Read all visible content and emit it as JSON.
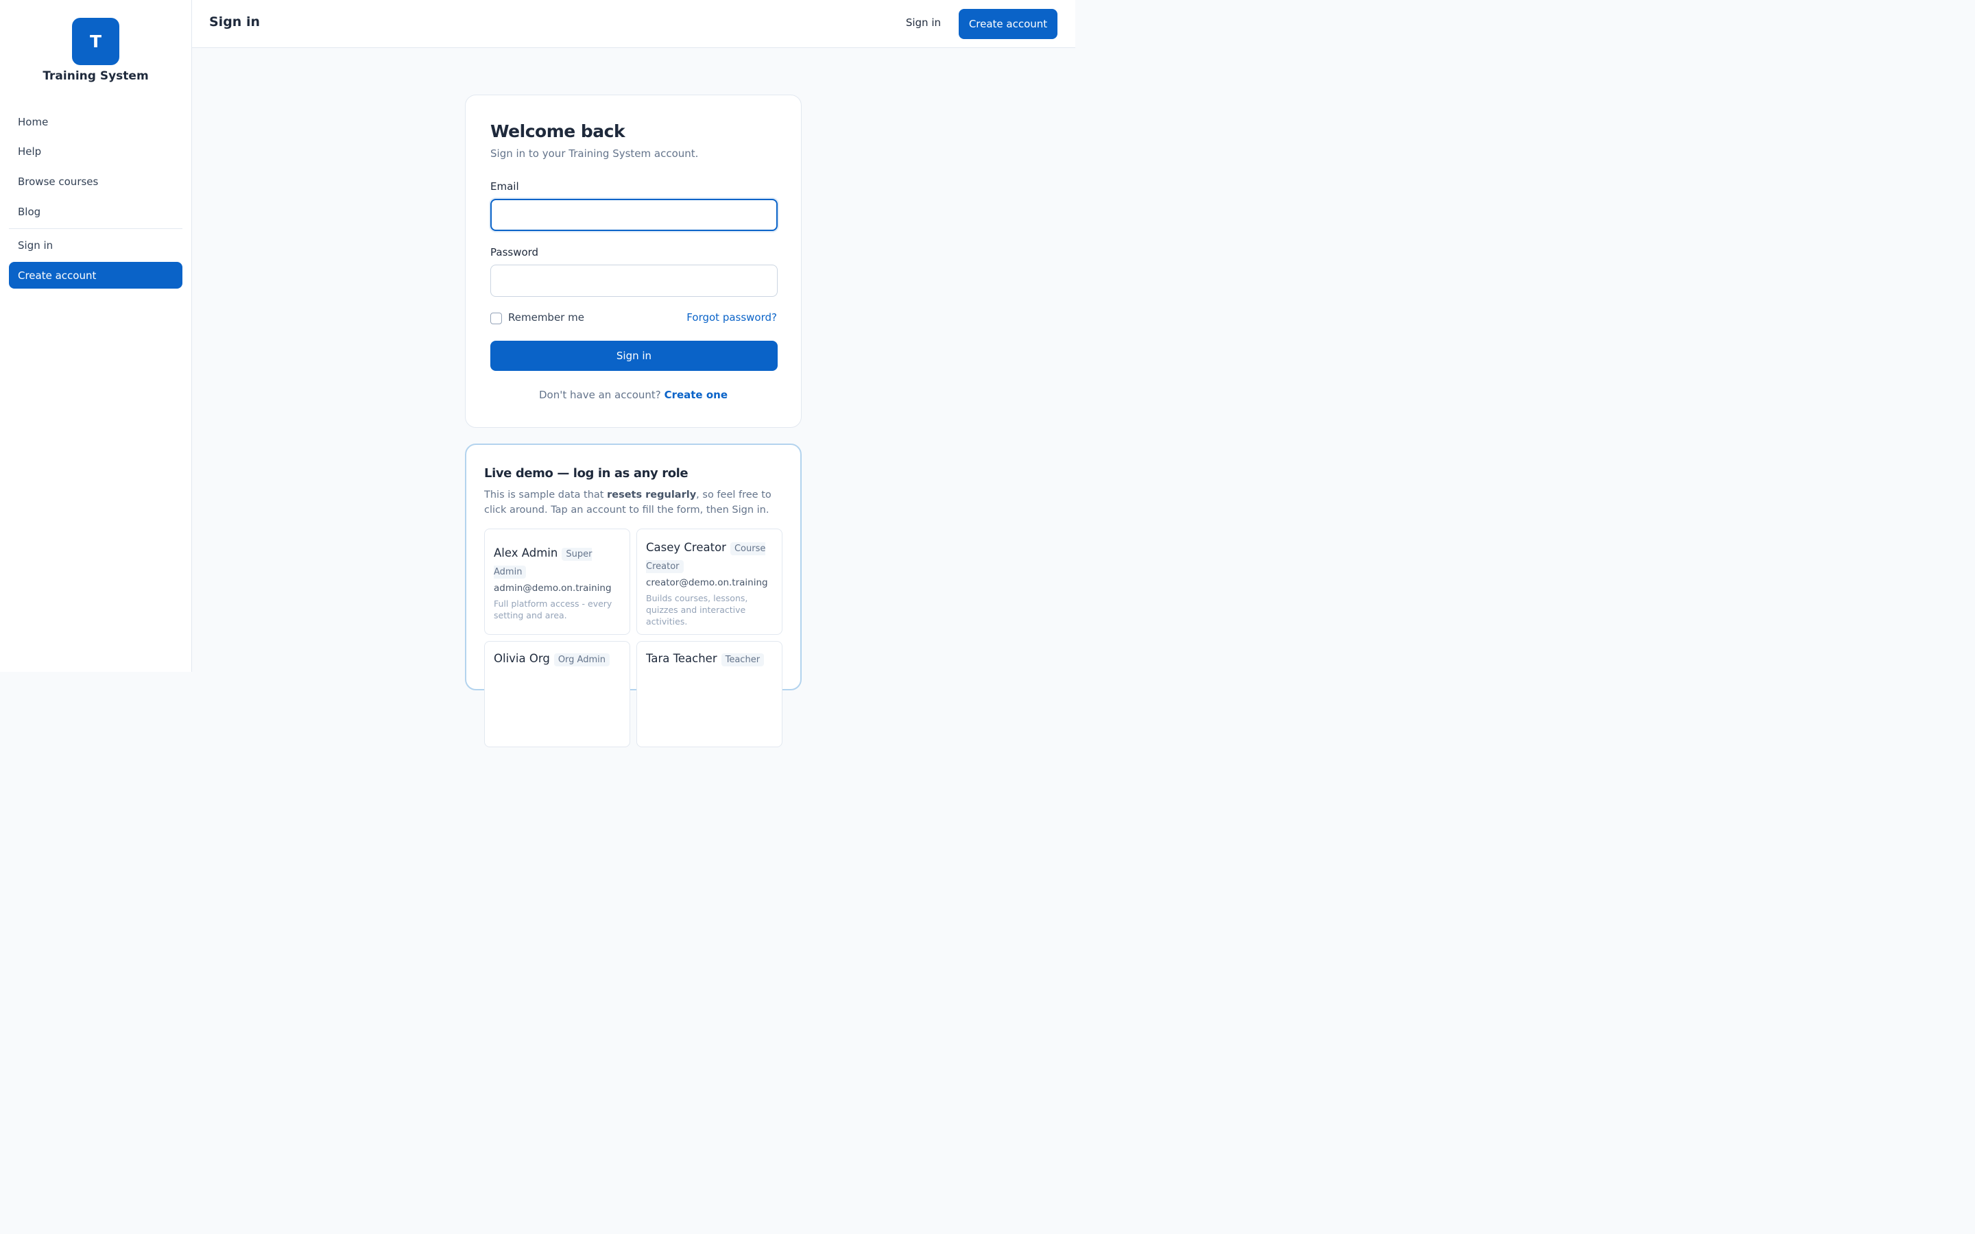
{
  "sidebar": {
    "logo_letter": "T",
    "brand": "Training System",
    "items": [
      {
        "label": "Home"
      },
      {
        "label": "Help"
      },
      {
        "label": "Browse courses"
      },
      {
        "label": "Blog"
      },
      {
        "label": "Sign in"
      },
      {
        "label": "Create account"
      }
    ]
  },
  "header": {
    "title": "Sign in",
    "signin_label": "Sign in",
    "create_label": "Create account"
  },
  "form": {
    "title": "Welcome back",
    "subtitle": "Sign in to your Training System account.",
    "email_label": "Email",
    "email_value": "",
    "password_label": "Password",
    "password_value": "",
    "remember_label": "Remember me",
    "forgot_label": "Forgot password?",
    "submit_label": "Sign in",
    "no_account_text": "Don't have an account?",
    "create_link": "Create one"
  },
  "demo": {
    "title": "Live demo — log in as any role",
    "desc_before": "This is sample data that ",
    "desc_bold": "resets regularly",
    "desc_after": ", so feel free to click around. Tap an account to fill the form, then Sign in.",
    "accounts": [
      {
        "name": "Alex Admin",
        "role": "Super Admin",
        "email": "admin@demo.on.training",
        "description": "Full platform access - every setting and area."
      },
      {
        "name": "Casey Creator",
        "role": "Course Creator",
        "email": "creator@demo.on.training",
        "description": "Builds courses, lessons, quizzes and interactive activities."
      },
      {
        "name": "Olivia Org",
        "role": "Org Admin",
        "email": "",
        "description": ""
      },
      {
        "name": "Tara Teacher",
        "role": "Teacher",
        "email": "",
        "description": ""
      }
    ]
  },
  "colors": {
    "accent": "#0a63c8",
    "sidebar_bg": "#ffffff",
    "page_bg": "#f8fafc",
    "demo_border": "#b3d3ee"
  }
}
